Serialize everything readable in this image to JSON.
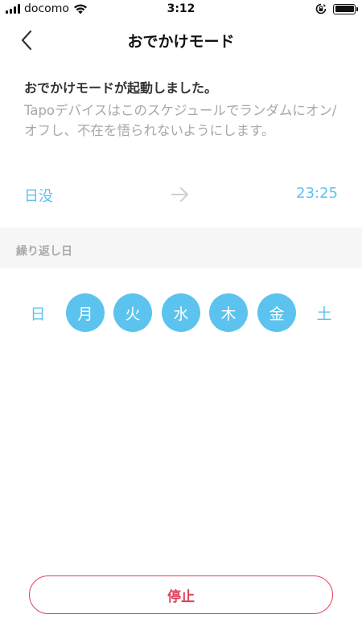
{
  "status_bar": {
    "carrier": "docomo",
    "time": "3:12",
    "battery_level": 1.0
  },
  "nav": {
    "title": "おでかけモード"
  },
  "message": {
    "headline": "おでかけモードが起動しました。",
    "description": "Tapoデバイスはこのスケジュールでランダムにオン/オフし、不在を悟られないようにします。"
  },
  "schedule": {
    "start": "日没",
    "end": "23:25"
  },
  "repeat": {
    "label": "繰り返し日",
    "days": [
      {
        "label": "日",
        "active": false
      },
      {
        "label": "月",
        "active": true
      },
      {
        "label": "火",
        "active": true
      },
      {
        "label": "水",
        "active": true
      },
      {
        "label": "木",
        "active": true
      },
      {
        "label": "金",
        "active": true
      },
      {
        "label": "土",
        "active": false
      }
    ]
  },
  "actions": {
    "stop_label": "停止"
  },
  "colors": {
    "accent": "#5bc3ee",
    "danger": "#e0405a",
    "muted_text": "#a8a8a8",
    "section_bg": "#f6f6f6"
  },
  "icons": {
    "back": "chevron-left-icon",
    "arrow": "arrow-right-icon",
    "wifi": "wifi-icon",
    "orientation_lock": "orientation-lock-icon",
    "battery": "battery-icon",
    "signal": "signal-bars-icon"
  }
}
